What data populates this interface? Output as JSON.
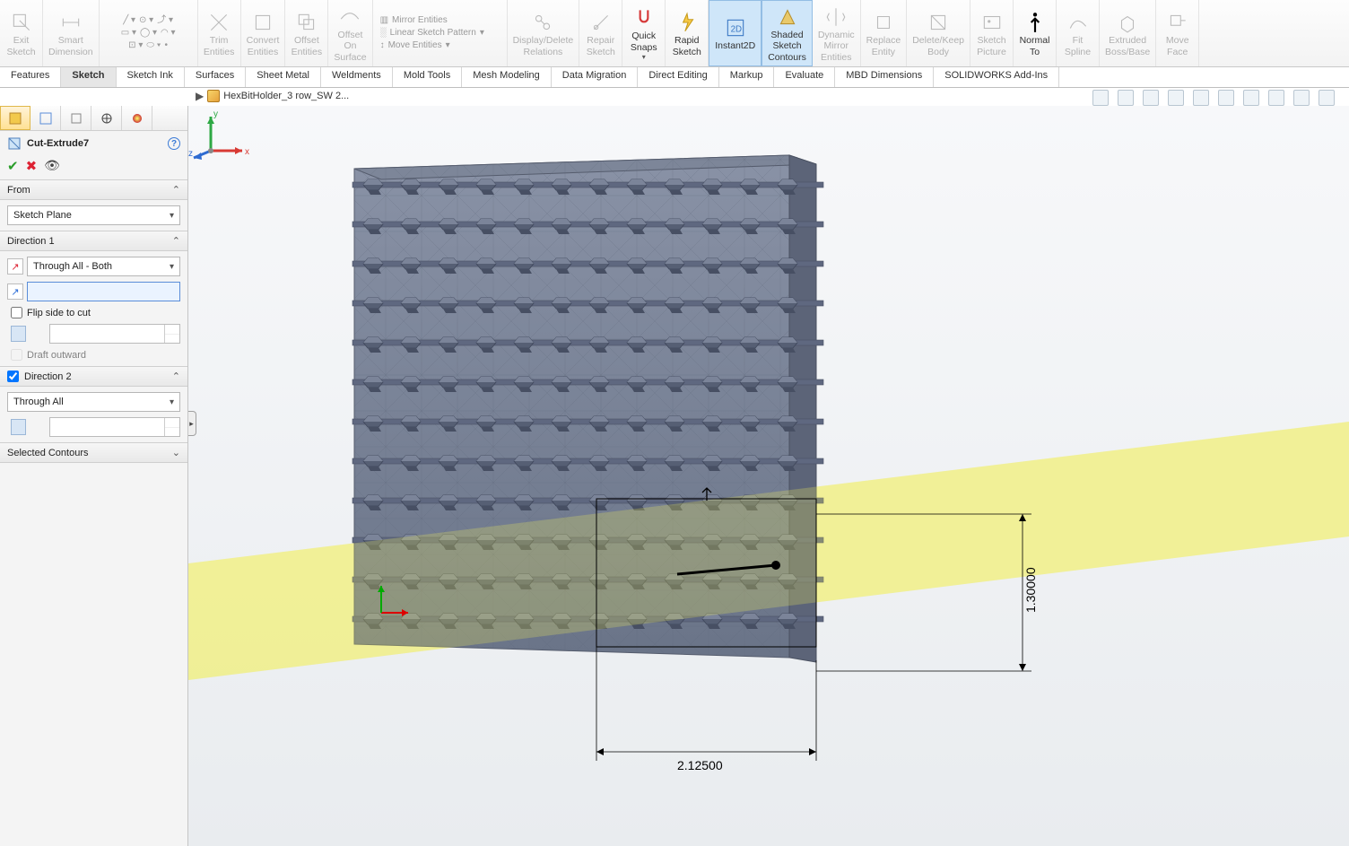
{
  "ribbon": {
    "exit_sketch": "Exit\nSketch",
    "smart_dim": "Smart\nDimension",
    "trim": "Trim\nEntities",
    "convert": "Convert\nEntities",
    "offset": "Offset\nEntities",
    "offset_surf": "Offset\nOn\nSurface",
    "mirror": "Mirror Entities",
    "linear": "Linear Sketch Pattern",
    "move": "Move Entities",
    "display_delete": "Display/Delete\nRelations",
    "repair": "Repair\nSketch",
    "quick": "Quick\nSnaps",
    "rapid": "Rapid\nSketch",
    "instant2d": "Instant2D",
    "shaded": "Shaded\nSketch\nContours",
    "dyn_mirror": "Dynamic\nMirror\nEntities",
    "replace": "Replace\nEntity",
    "deletekeep": "Delete/Keep\nBody",
    "sketch_pic": "Sketch\nPicture",
    "normal": "Normal\nTo",
    "fit_spline": "Fit\nSpline",
    "extr_boss": "Extruded\nBoss/Base",
    "move_face": "Move\nFace"
  },
  "tabs": [
    "Features",
    "Sketch",
    "Sketch Ink",
    "Surfaces",
    "Sheet Metal",
    "Weldments",
    "Mold Tools",
    "Mesh Modeling",
    "Data Migration",
    "Direct Editing",
    "Markup",
    "Evaluate",
    "MBD Dimensions",
    "SOLIDWORKS Add-Ins"
  ],
  "active_tab": "Sketch",
  "breadcrumb": "HexBitHolder_3 row_SW 2...",
  "pm": {
    "feature_name": "Cut-Extrude7",
    "from_label": "From",
    "from_value": "Sketch Plane",
    "dir1_label": "Direction 1",
    "dir1_value": "Through All - Both",
    "flip_side": "Flip side to cut",
    "draft_out": "Draft outward",
    "dir2_label": "Direction 2",
    "dir2_value": "Through All",
    "sel_contours": "Selected Contours"
  },
  "dims": {
    "h": "2.12500",
    "v": "1.30000"
  },
  "triad": {
    "x": "x",
    "y": "y",
    "z": "z"
  }
}
